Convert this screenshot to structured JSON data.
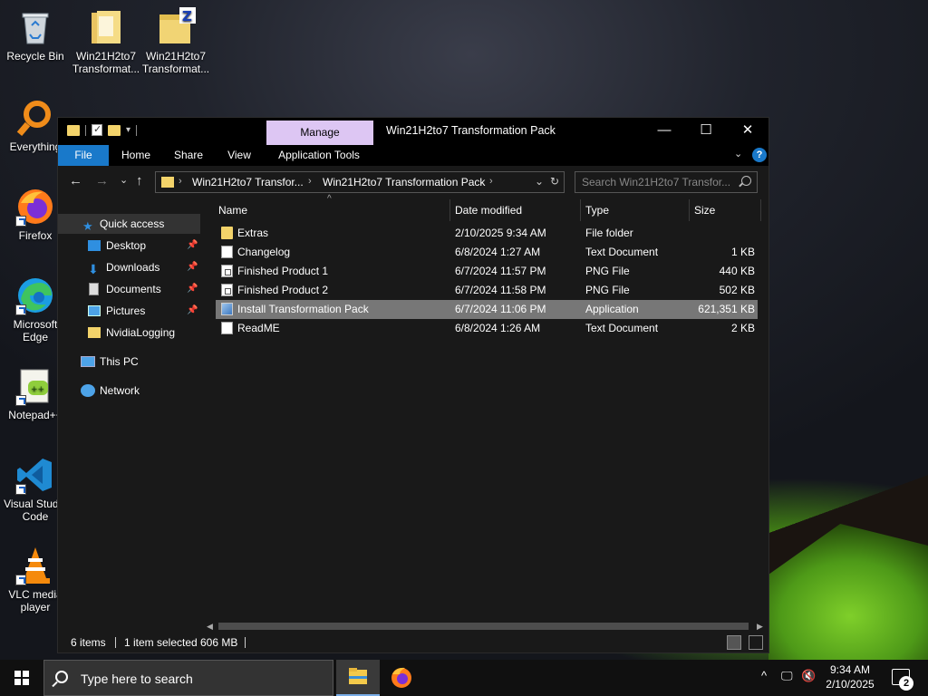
{
  "desktop": {
    "icons": [
      {
        "label": "Recycle Bin"
      },
      {
        "label": "Win21H2to7 Transformat..."
      },
      {
        "label": "Win21H2to7 Transformat..."
      },
      {
        "label": "Everything"
      },
      {
        "label": "Firefox"
      },
      {
        "label": "Microsoft Edge"
      },
      {
        "label": "Notepad++"
      },
      {
        "label": "Visual Studio Code"
      },
      {
        "label": "VLC media player"
      }
    ]
  },
  "window": {
    "title": "Win21H2to7 Transformation Pack",
    "context_tab": "Manage",
    "ribbon_tabs": [
      "File",
      "Home",
      "Share",
      "View",
      "Application Tools"
    ],
    "address": {
      "crumbs": [
        "Win21H2to7 Transfor...",
        "Win21H2to7 Transformation Pack"
      ]
    },
    "search": {
      "placeholder": "Search Win21H2to7 Transfor..."
    },
    "nav": {
      "quick_access": "Quick access",
      "items": [
        "Desktop",
        "Downloads",
        "Documents",
        "Pictures",
        "NvidiaLogging"
      ],
      "this_pc": "This PC",
      "network": "Network"
    },
    "columns": [
      "Name",
      "Date modified",
      "Type",
      "Size"
    ],
    "files": [
      {
        "name": "Extras",
        "date": "2/10/2025 9:34 AM",
        "type": "File folder",
        "size": "",
        "icon": "folder-icon"
      },
      {
        "name": "Changelog",
        "date": "6/8/2024 1:27 AM",
        "type": "Text Document",
        "size": "1 KB",
        "icon": "text-document-icon"
      },
      {
        "name": "Finished Product 1",
        "date": "6/7/2024 11:57 PM",
        "type": "PNG File",
        "size": "440 KB",
        "icon": "image-file-icon"
      },
      {
        "name": "Finished Product 2",
        "date": "6/7/2024 11:58 PM",
        "type": "PNG File",
        "size": "502 KB",
        "icon": "image-file-icon"
      },
      {
        "name": "Install Transformation Pack",
        "date": "6/7/2024 11:06 PM",
        "type": "Application",
        "size": "621,351 KB",
        "icon": "application-icon"
      },
      {
        "name": "ReadME",
        "date": "6/8/2024 1:26 AM",
        "type": "Text Document",
        "size": "2 KB",
        "icon": "text-document-icon"
      }
    ],
    "selected_row": 4,
    "status": {
      "count": "6 items",
      "selected": "1 item selected",
      "size": "606 MB"
    }
  },
  "taskbar": {
    "search_placeholder": "Type here to search",
    "time": "9:34 AM",
    "date": "2/10/2025",
    "notification_count": "2"
  },
  "colors": {
    "accent": "#1979ca",
    "manage_tab": "#ddc6f3",
    "selected_row": "#777777"
  }
}
